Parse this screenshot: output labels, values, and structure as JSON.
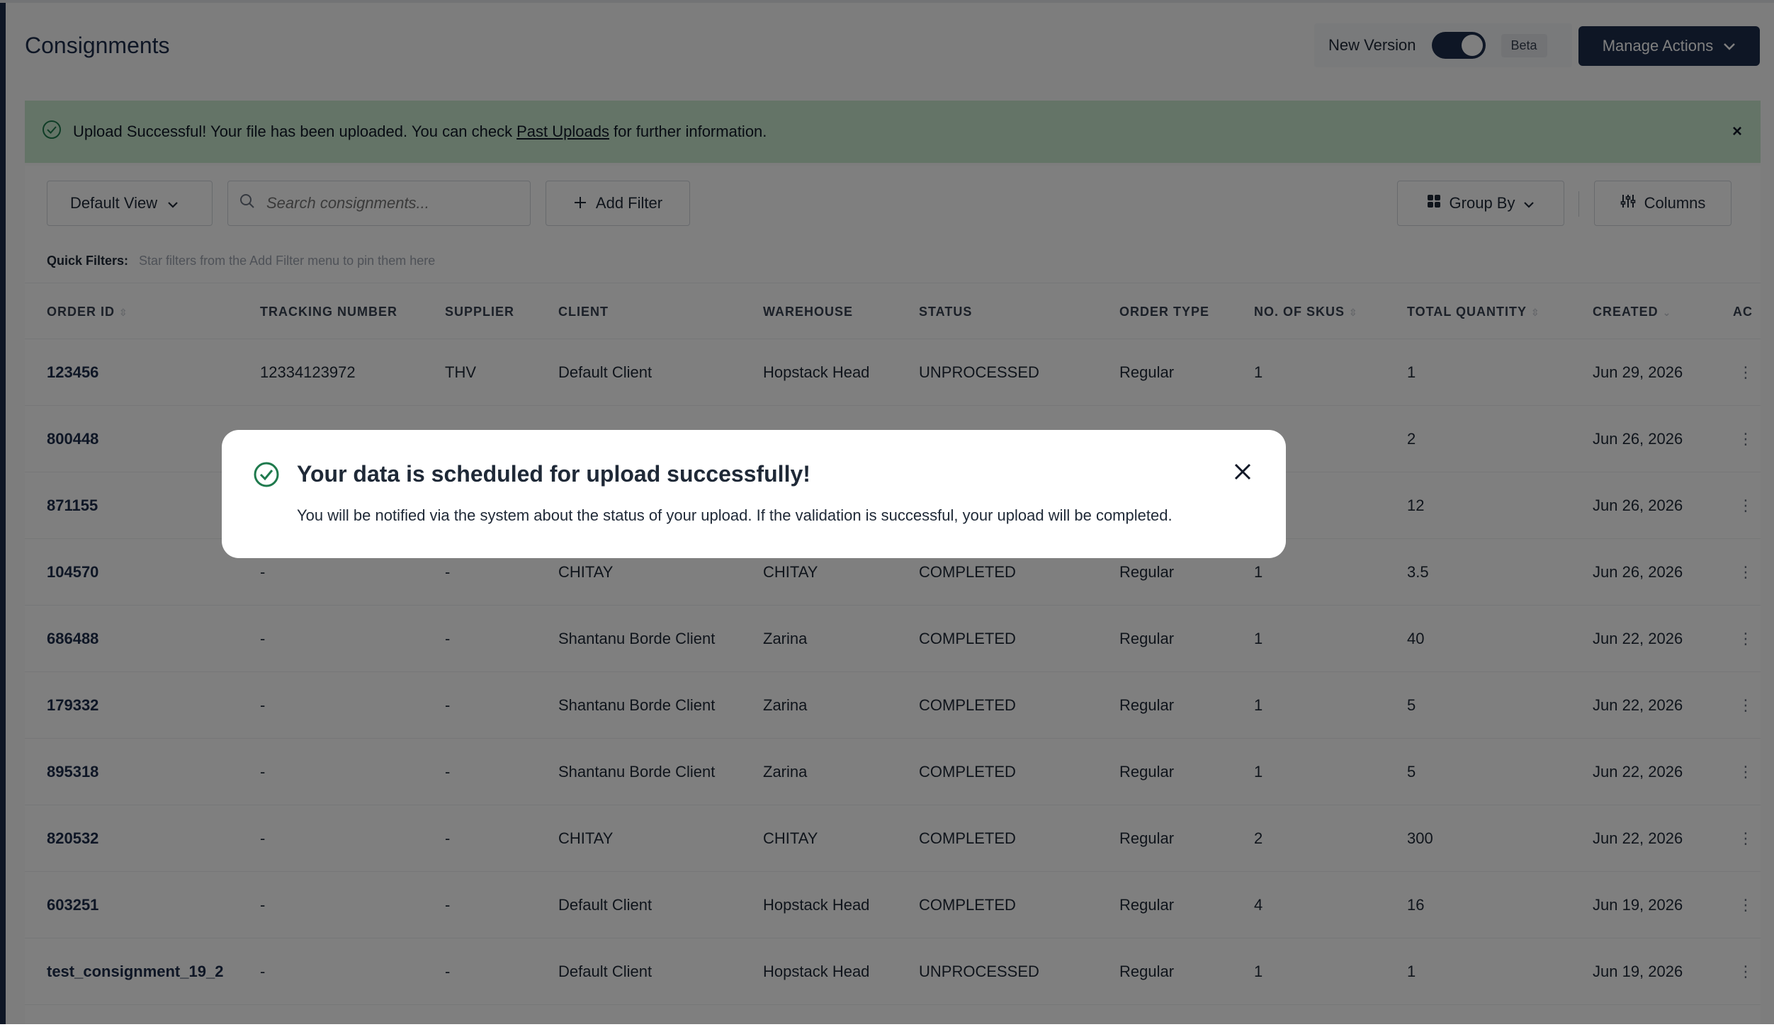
{
  "header": {
    "title": "Consignments",
    "new_version_label": "New Version",
    "beta_label": "Beta",
    "manage_actions_label": "Manage Actions"
  },
  "banner": {
    "text_before": "Upload Successful! Your file has been uploaded. You can check",
    "link_text": "Past Uploads",
    "text_after": "for further information.",
    "close": "×"
  },
  "toolbar": {
    "default_view_label": "Default View",
    "search_placeholder": "Search consignments...",
    "add_filter_label": "Add Filter",
    "group_by_label": "Group By",
    "columns_label": "Columns"
  },
  "quick_filters": {
    "label": "Quick Filters:",
    "hint": "Star filters from the Add Filter menu to pin them here"
  },
  "table": {
    "columns": [
      "ORDER ID",
      "TRACKING NUMBER",
      "SUPPLIER",
      "CLIENT",
      "WAREHOUSE",
      "STATUS",
      "ORDER TYPE",
      "NO. OF SKUS",
      "TOTAL QUANTITY",
      "CREATED",
      "AC"
    ],
    "rows": [
      [
        "123456",
        "12334123972",
        "THV",
        "Default Client",
        "Hopstack Head",
        "UNPROCESSED",
        "Regular",
        "1",
        "1",
        "Jun 29, 2026"
      ],
      [
        "800448",
        "",
        "",
        "",
        "",
        "",
        "",
        "",
        "2",
        "Jun 26, 2026"
      ],
      [
        "871155",
        "",
        "",
        "",
        "",
        "",
        "",
        "",
        "12",
        "Jun 26, 2026"
      ],
      [
        "104570",
        "-",
        "-",
        "CHITAY",
        "CHITAY",
        "COMPLETED",
        "Regular",
        "1",
        "3.5",
        "Jun 26, 2026"
      ],
      [
        "686488",
        "-",
        "-",
        "Shantanu Borde Client",
        "Zarina",
        "COMPLETED",
        "Regular",
        "1",
        "40",
        "Jun 22, 2026"
      ],
      [
        "179332",
        "-",
        "-",
        "Shantanu Borde Client",
        "Zarina",
        "COMPLETED",
        "Regular",
        "1",
        "5",
        "Jun 22, 2026"
      ],
      [
        "895318",
        "-",
        "-",
        "Shantanu Borde Client",
        "Zarina",
        "COMPLETED",
        "Regular",
        "1",
        "5",
        "Jun 22, 2026"
      ],
      [
        "820532",
        "-",
        "-",
        "CHITAY",
        "CHITAY",
        "COMPLETED",
        "Regular",
        "2",
        "300",
        "Jun 22, 2026"
      ],
      [
        "603251",
        "-",
        "-",
        "Default Client",
        "Hopstack Head",
        "COMPLETED",
        "Regular",
        "4",
        "16",
        "Jun 19, 2026"
      ],
      [
        "test_consignment_19_2",
        "-",
        "-",
        "Default Client",
        "Hopstack Head",
        "UNPROCESSED",
        "Regular",
        "1",
        "1",
        "Jun 19, 2026"
      ]
    ]
  },
  "modal": {
    "title": "Your data is scheduled for upload successfully!",
    "body": "You will be notified via the system about the status of your upload. If the validation is successful, your upload will be completed."
  },
  "colors": {
    "navy": "#1d2c4a",
    "banner_green": "#c9e8cf",
    "success_icon": "#1f7a4d"
  },
  "icons": [
    "check-circle-icon",
    "close-icon",
    "chevron-down-icon",
    "search-icon",
    "plus-icon",
    "grid-icon",
    "sliders-icon",
    "kebab-icon",
    "sort-icon"
  ]
}
